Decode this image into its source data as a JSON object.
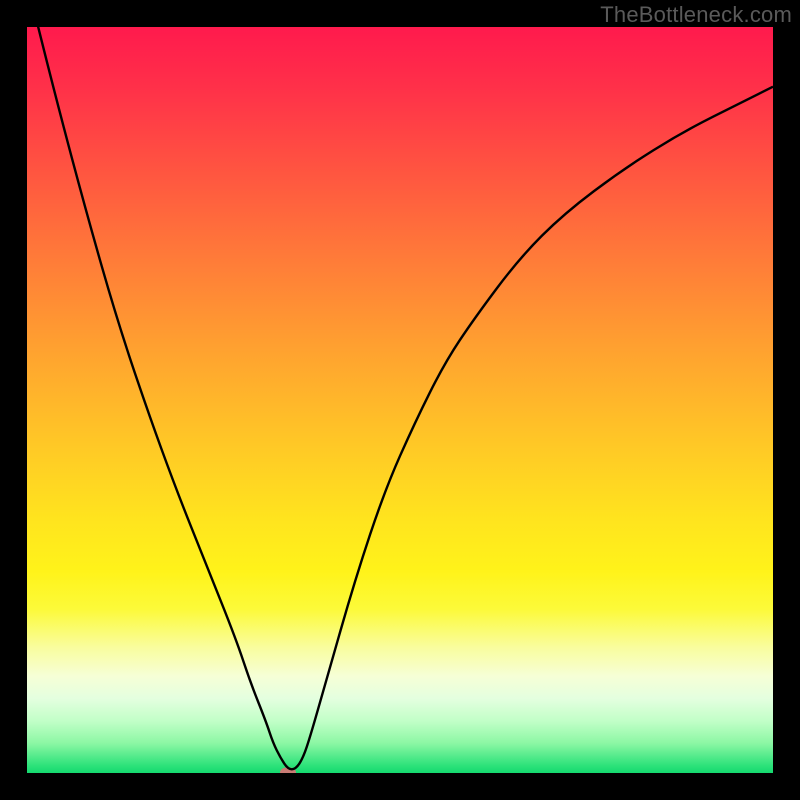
{
  "watermark": "TheBottleneck.com",
  "colors": {
    "frame": "#000000",
    "curve": "#000000",
    "marker": "#c97b74",
    "text": "#5a5a5a"
  },
  "chart_data": {
    "type": "line",
    "title": "",
    "xlabel": "",
    "ylabel": "",
    "xlim": [
      0,
      100
    ],
    "ylim": [
      0,
      100
    ],
    "grid": false,
    "legend": false,
    "x": [
      0,
      4,
      8,
      12,
      16,
      20,
      24,
      28,
      30,
      32,
      33,
      34,
      35,
      36,
      37,
      38,
      40,
      44,
      48,
      52,
      56,
      60,
      66,
      72,
      80,
      88,
      96,
      100
    ],
    "values": [
      106,
      90,
      75,
      61,
      49,
      38,
      28,
      18,
      12,
      7,
      4,
      2,
      0.5,
      0.5,
      2,
      5,
      12,
      26,
      38,
      47,
      55,
      61,
      69,
      75,
      81,
      86,
      90,
      92
    ],
    "min_point": {
      "x": 35,
      "y": 0
    },
    "background_gradient": {
      "type": "vertical",
      "stops": [
        {
          "pos": 0.0,
          "color": "#ff1a4d"
        },
        {
          "pos": 0.4,
          "color": "#ff9a30"
        },
        {
          "pos": 0.7,
          "color": "#ffe820"
        },
        {
          "pos": 0.9,
          "color": "#daffd0"
        },
        {
          "pos": 1.0,
          "color": "#14d96f"
        }
      ]
    }
  }
}
